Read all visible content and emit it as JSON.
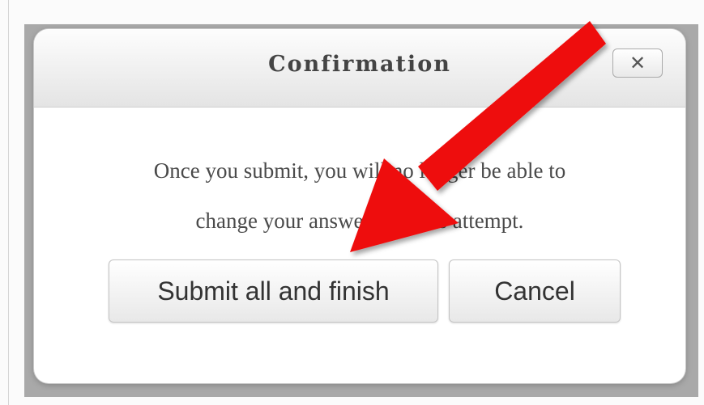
{
  "dialog": {
    "title": "Confirmation",
    "close_label": "✕",
    "message_line1": "Once you submit, you will no longer be able to",
    "message_line2": "change your answers for this attempt.",
    "submit_label": "Submit all and finish",
    "cancel_label": "Cancel"
  },
  "annotation": {
    "arrow_color": "#ee0d0d",
    "arrow_target": "submit-all-and-finish-button"
  }
}
